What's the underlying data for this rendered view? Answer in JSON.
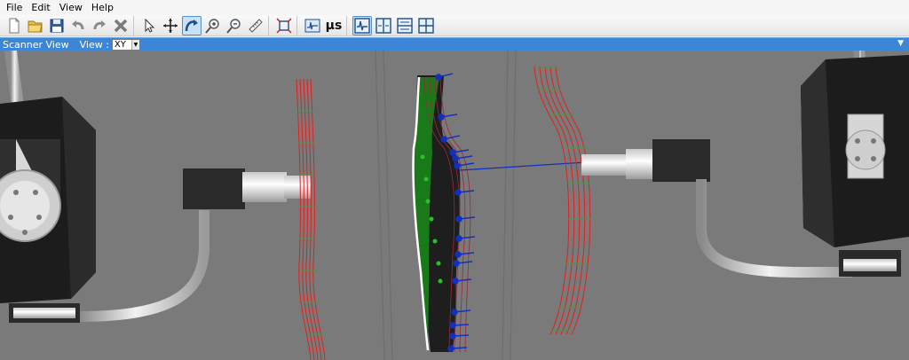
{
  "menu": {
    "items": [
      "File",
      "Edit",
      "View",
      "Help"
    ]
  },
  "toolbar": {
    "buttons": [
      {
        "icon": "new-file-icon"
      },
      {
        "icon": "open-folder-icon"
      },
      {
        "icon": "save-icon"
      },
      {
        "icon": "undo-icon"
      },
      {
        "icon": "redo-icon"
      },
      {
        "icon": "delete-icon"
      },
      {
        "icon": "select-arrow-icon"
      },
      {
        "icon": "move-icon"
      },
      {
        "icon": "rotate-icon",
        "active": true
      },
      {
        "icon": "zoom-in-icon"
      },
      {
        "icon": "zoom-out-icon"
      },
      {
        "icon": "measure-icon"
      },
      {
        "icon": "fit-view-icon"
      },
      {
        "icon": "signal-view-icon"
      },
      {
        "icon": "ascan-view-icon",
        "active": true
      },
      {
        "icon": "layout-split-vertical-icon"
      },
      {
        "icon": "layout-split-horizontal-icon"
      },
      {
        "icon": "layout-grid-icon"
      }
    ],
    "time_unit_label": "µs"
  },
  "scanner_panel": {
    "title": "Scanner View",
    "view_label": "View :",
    "view_value": "XY"
  },
  "colors": {
    "panel_title": "#3b86d6",
    "viewport_bg": "#7a7a7a",
    "scan_red": "#e02020",
    "part_green": "#1a7a1a",
    "probe_blue": "#1030c0"
  }
}
